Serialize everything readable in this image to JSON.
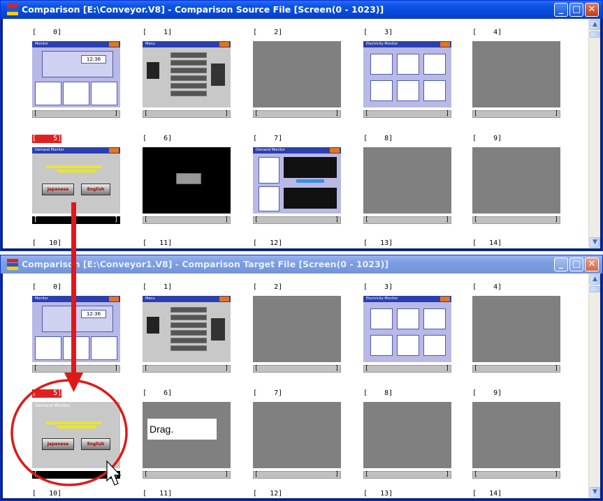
{
  "colors": {
    "title_active": "#0a54e3",
    "title_inactive": "#7d9ee3",
    "selected_label": "#e02020",
    "annotation": "#e01818"
  },
  "source_window": {
    "title": "Comparison [E:\\Conveyor.V8] - Comparison Source File [Screen(0 - 1023)]",
    "min_label": "_",
    "max_label": "□",
    "close_label": "✕",
    "row1_labels": [
      "[    0]",
      "[    1]",
      "[    2]",
      "[    3]",
      "[    4]"
    ],
    "row2_labels": [
      "[    5]",
      "[    6]",
      "[    7]",
      "[    8]",
      "[    9]"
    ],
    "row3_labels": [
      "[   10]",
      "[   11]",
      "[   12]",
      "[   13]",
      "[   14]"
    ],
    "thumb_titles": [
      "Monitor",
      "Menu",
      "Electricity Monitor",
      "Demand Monitor",
      "Demand Monitor"
    ],
    "buttons": {
      "japanese": "Japanese",
      "english": "English"
    },
    "bar_left": "[",
    "bar_right": "]"
  },
  "target_window": {
    "title": "Comparison [E:\\Conveyor1.V8] - Comparison Target File [Screen(0 - 1023)]",
    "min_label": "_",
    "max_label": "□",
    "close_label": "✕",
    "row1_labels": [
      "[    0]",
      "[    1]",
      "[    2]",
      "[    3]",
      "[    4]"
    ],
    "row2_labels": [
      "[    5]",
      "[    6]",
      "[    7]",
      "[    8]",
      "[    9]"
    ],
    "row3_labels": [
      "[   10]",
      "[   11]",
      "[   12]",
      "[   13]",
      "[   14]"
    ],
    "thumb_titles": [
      "Monitor",
      "Menu",
      "Electricity Monitor",
      "Demand Monitor"
    ],
    "buttons": {
      "japanese": "Japanese",
      "english": "English"
    }
  },
  "annotation": {
    "drag_label": "Drag."
  }
}
